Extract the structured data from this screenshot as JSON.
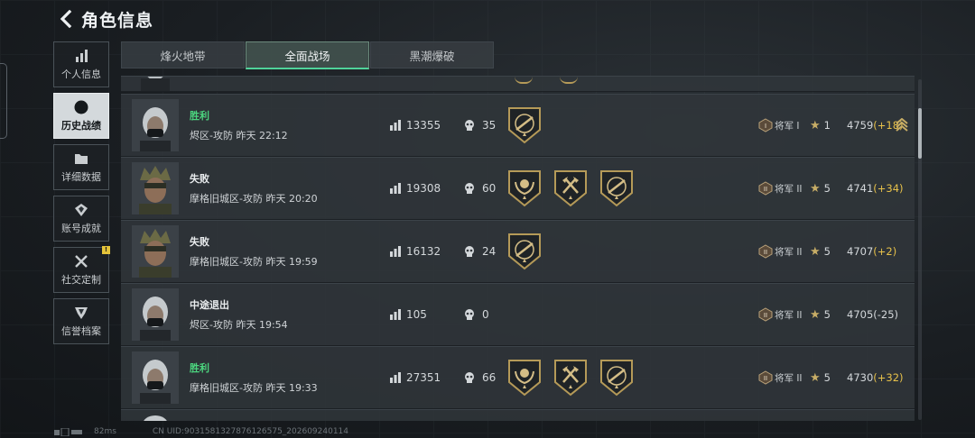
{
  "header": {
    "title": "角色信息"
  },
  "sidebar": {
    "items": [
      {
        "label": "个人信息",
        "icon": "bar-chart-icon"
      },
      {
        "label": "历史战绩",
        "icon": "clock-icon",
        "active": true
      },
      {
        "label": "详细数据",
        "icon": "folder-icon"
      },
      {
        "label": "账号成就",
        "icon": "medal-icon"
      },
      {
        "label": "社交定制",
        "icon": "tools-icon",
        "badge": "!"
      },
      {
        "label": "信誉档案",
        "icon": "shield-icon"
      }
    ]
  },
  "tabs": [
    {
      "label": "烽火地带"
    },
    {
      "label": "全面战场",
      "active": true
    },
    {
      "label": "黑潮爆破"
    }
  ],
  "matches": [
    {
      "result": "胜利",
      "result_type": "win",
      "map": "烬区-攻防 昨天 22:12",
      "score_stat": "13355",
      "kills": "35",
      "medals": [
        "rifle-medal-icon"
      ],
      "rank": "将军 I",
      "rank_icon": "I",
      "stars": "1",
      "rating": "4759",
      "delta": "(+18)",
      "delta_type": "pos",
      "streak": true
    },
    {
      "result": "失败",
      "result_type": "lose",
      "map": "摩格旧城区-攻防 昨天 20:20",
      "score_stat": "19308",
      "kills": "60",
      "medals": [
        "laurel-medal-icon",
        "axes-medal-icon",
        "rifle-medal-icon"
      ],
      "rank": "将军 II",
      "rank_icon": "II",
      "stars": "5",
      "rating": "4741",
      "delta": "(+34)",
      "delta_type": "pos"
    },
    {
      "result": "失败",
      "result_type": "lose",
      "map": "摩格旧城区-攻防 昨天 19:59",
      "score_stat": "16132",
      "kills": "24",
      "medals": [
        "rifle-medal-icon"
      ],
      "rank": "将军 II",
      "rank_icon": "II",
      "stars": "5",
      "rating": "4707",
      "delta": "(+2)",
      "delta_type": "pos"
    },
    {
      "result": "中途退出",
      "result_type": "quit",
      "map": "烬区-攻防 昨天 19:54",
      "score_stat": "105",
      "kills": "0",
      "medals": [],
      "rank": "将军 II",
      "rank_icon": "II",
      "stars": "5",
      "rating": "4705",
      "delta": "(-25)",
      "delta_type": "neg"
    },
    {
      "result": "胜利",
      "result_type": "win",
      "map": "摩格旧城区-攻防 昨天 19:33",
      "score_stat": "27351",
      "kills": "66",
      "medals": [
        "laurel-medal-icon",
        "axes-medal-icon",
        "rifle-medal-icon"
      ],
      "rank": "将军 II",
      "rank_icon": "II",
      "stars": "5",
      "rating": "4730",
      "delta": "(+32)",
      "delta_type": "pos"
    }
  ],
  "footer": {
    "ping": "82ms",
    "uid": "CN UID:9031581327876126575_202609240114"
  },
  "colors": {
    "win": "#4bd47e",
    "positive_delta": "#e7c14a",
    "tab_active_underline": "#4fd39a"
  }
}
